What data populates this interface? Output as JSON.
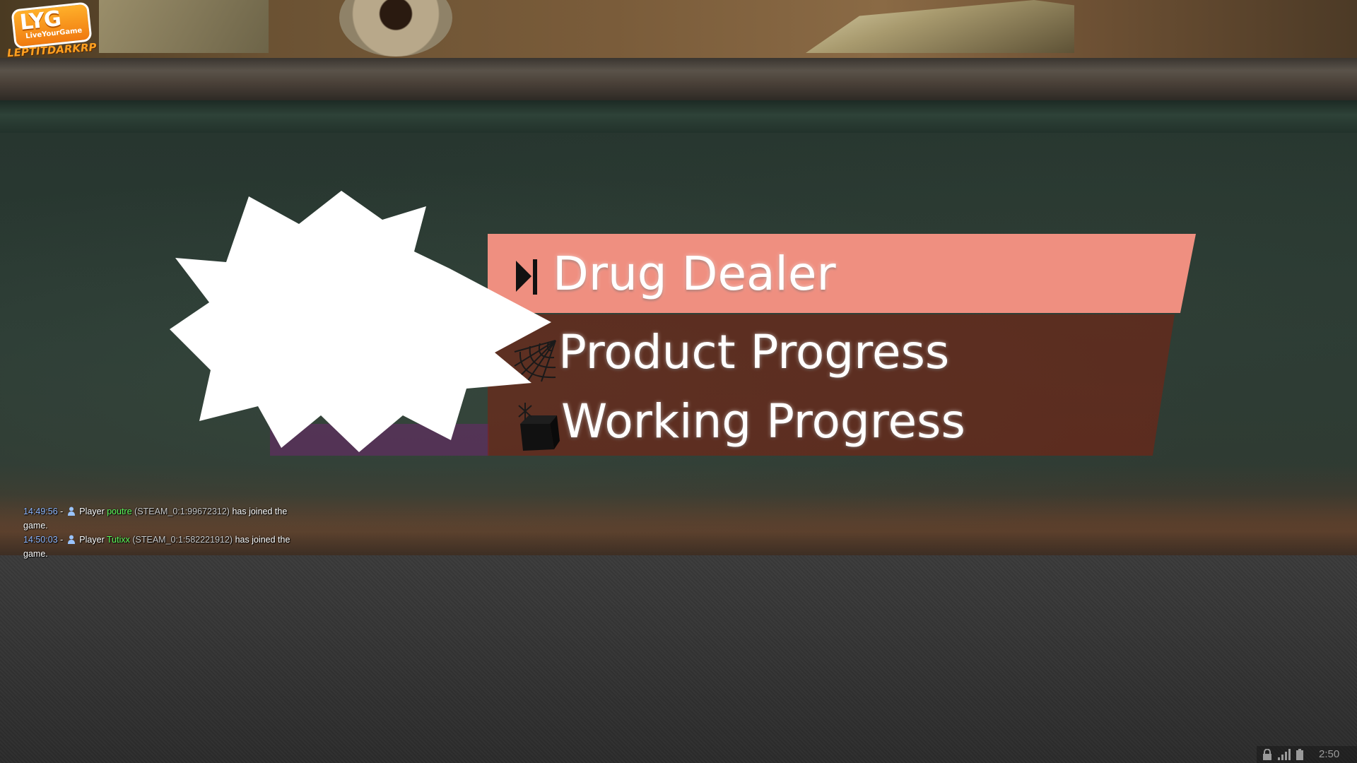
{
  "logo": {
    "brand": "LYG",
    "tagline": "LiveYourGame",
    "server": "LEPTITDARKRP"
  },
  "menu": {
    "items": [
      {
        "label": "Drug Dealer",
        "icon": "dealer-icon",
        "selected": true
      },
      {
        "label": "Product Progress",
        "icon": "spider-web-icon",
        "selected": false
      },
      {
        "label": "Working Progress",
        "icon": "box-icon",
        "selected": false
      }
    ],
    "colors": {
      "selected": "#ef8f80",
      "panel": "#78240f"
    }
  },
  "chat": {
    "messages": [
      {
        "time": "14:49:56",
        "sep": "-",
        "prefix": "Player",
        "name": "poutre",
        "steam_id": "(STEAM_0:1:99672312)",
        "text": "has joined the game."
      },
      {
        "time": "14:50:03",
        "sep": "-",
        "prefix": "Player",
        "name": "Tutixx",
        "steam_id": "(STEAM_0:1:582221912)",
        "text": "has joined the game."
      }
    ]
  },
  "tray": {
    "clock": "2:50",
    "icons": [
      "lock-icon",
      "signal-icon",
      "battery-icon"
    ]
  }
}
